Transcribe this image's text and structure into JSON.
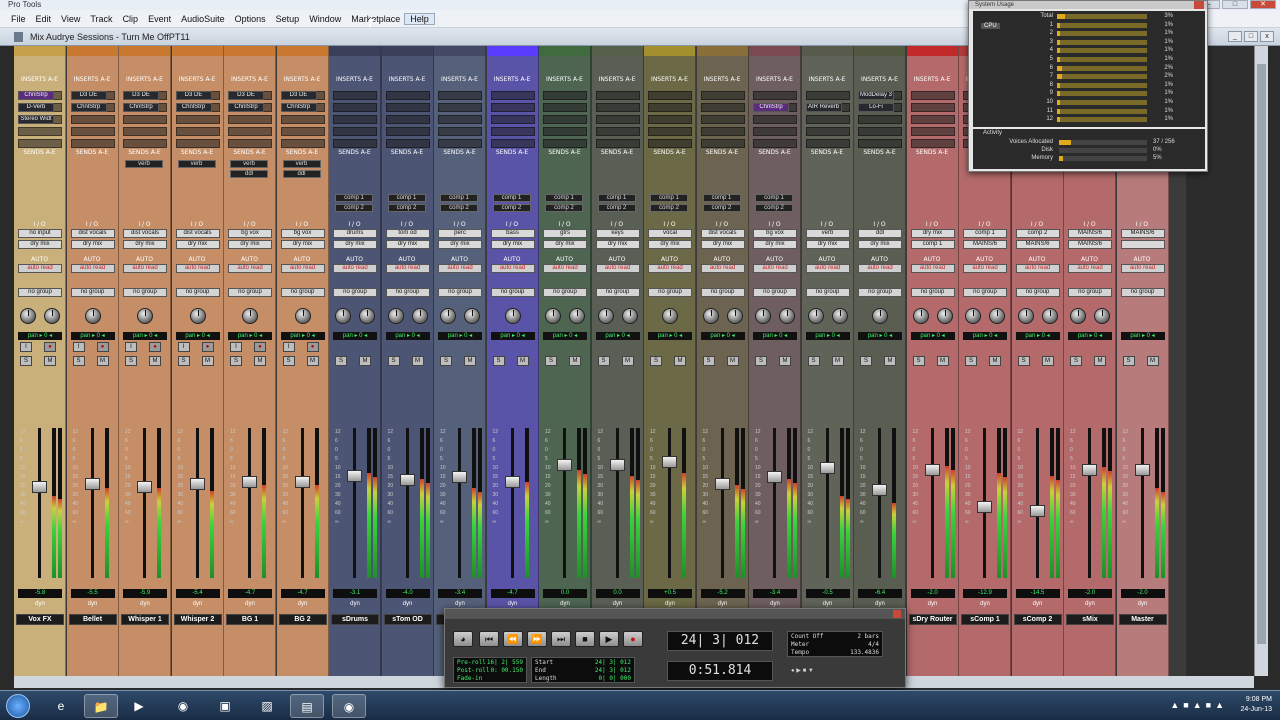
{
  "app": {
    "window_title": "Pro Tools",
    "session_title": "Mix Audrye Sessions - Turn Me OffPT11"
  },
  "menu": [
    "File",
    "Edit",
    "View",
    "Track",
    "Clip",
    "Event",
    "AudioSuite",
    "Options",
    "Setup",
    "Window",
    "Marketplace",
    "Help"
  ],
  "mixer": {
    "inserts_label": "INSERTS A-E",
    "sends_label": "SENDS A-E",
    "io_label": "I / O",
    "auto_label": "AUTO",
    "auto_mode": "auto read",
    "group_label": "no group",
    "pan_value": "pan ▸ 0 ◂",
    "dyn_label": "dyn",
    "scale": [
      "12",
      "6",
      "0",
      "5",
      "10",
      "15",
      "20",
      "30",
      "40",
      "60",
      "∞"
    ],
    "strips": [
      {
        "name": "Vox FX",
        "color": "#c9b07a",
        "top": "#c8a24a",
        "inserts": [
          "ChnlStrp",
          "D-Verb",
          "Stereo Widt"
        ],
        "sends": [],
        "input": "no input",
        "output": "dry mix",
        "vol": "-5.8",
        "fader": 0.38,
        "meter": 0.55,
        "knobs": 2
      },
      {
        "name": "Bellet",
        "color": "#c58e66",
        "top": "#c8792f",
        "inserts": [
          "D3 DE",
          "ChnlStrp"
        ],
        "sends": [],
        "input": "dist vocals",
        "output": "dry mix",
        "vol": "-5.5",
        "fader": 0.36,
        "meter": 0.6,
        "knobs": 1
      },
      {
        "name": "Whisper 1",
        "color": "#c58e66",
        "top": "#c8792f",
        "inserts": [
          "D3 DE",
          "ChnlStrp"
        ],
        "sends": [
          "verb"
        ],
        "input": "dist vocals",
        "output": "dry mix",
        "vol": "-5.9",
        "fader": 0.38,
        "meter": 0.6,
        "knobs": 1
      },
      {
        "name": "Whisper 2",
        "color": "#c58e66",
        "top": "#c8792f",
        "inserts": [
          "D3 DE",
          "ChnlStrp"
        ],
        "sends": [
          "verb"
        ],
        "input": "dist vocals",
        "output": "dry mix",
        "vol": "-5.4",
        "fader": 0.36,
        "meter": 0.58,
        "knobs": 1
      },
      {
        "name": "BG 1",
        "color": "#c58e66",
        "top": "#c8792f",
        "inserts": [
          "D3 DE",
          "ChnlStrp"
        ],
        "sends": [
          "verb",
          "ddl"
        ],
        "input": "bg vox",
        "output": "dry mix",
        "vol": "-4.7",
        "fader": 0.34,
        "meter": 0.62,
        "knobs": 1
      },
      {
        "name": "BG 2",
        "color": "#c58e66",
        "top": "#c8792f",
        "inserts": [
          "D3 DE",
          "ChnlStrp"
        ],
        "sends": [
          "verb",
          "ddl"
        ],
        "input": "bg vox",
        "output": "dry mix",
        "vol": "-4.7",
        "fader": 0.34,
        "meter": 0.62,
        "knobs": 1
      },
      {
        "name": "sDrums",
        "color": "#4d5574",
        "top": "#3c3f5a",
        "inserts": [],
        "sends": [
          "comp 1",
          "comp 2"
        ],
        "input": "drums",
        "output": "dry mix",
        "vol": "-3.1",
        "fader": 0.3,
        "meter": 0.7,
        "knobs": 2
      },
      {
        "name": "sTom OD",
        "color": "#4d5574",
        "top": "#3c3f5a",
        "inserts": [],
        "sends": [
          "comp 1",
          "comp 2"
        ],
        "input": "tom od",
        "output": "dry mix",
        "vol": "-4.0",
        "fader": 0.33,
        "meter": 0.66,
        "knobs": 2
      },
      {
        "name": "sPerc",
        "color": "#55607a",
        "top": "#444a66",
        "inserts": [],
        "sends": [
          "comp 1",
          "comp 2"
        ],
        "input": "perc",
        "output": "dry mix",
        "vol": "-3.4",
        "fader": 0.31,
        "meter": 0.6,
        "knobs": 2
      },
      {
        "name": "sBass",
        "color": "#5a54a8",
        "top": "#5a3cff",
        "inserts": [],
        "sends": [
          "comp 1",
          "comp 2"
        ],
        "input": "bass",
        "output": "dry mix",
        "vol": "-4.7",
        "fader": 0.34,
        "meter": 0.64,
        "knobs": 1
      },
      {
        "name": "sGtrs",
        "color": "#4e6552",
        "top": "#406b3f",
        "inserts": [],
        "sends": [
          "comp 1",
          "comp 2"
        ],
        "input": "gtrs",
        "output": "dry mix",
        "vol": "0.0",
        "fader": 0.22,
        "meter": 0.72,
        "knobs": 2
      },
      {
        "name": "sKeys",
        "color": "#5a5f55",
        "top": "#56604a",
        "inserts": [],
        "sends": [
          "comp 1",
          "comp 2"
        ],
        "input": "keys",
        "output": "dry mix",
        "vol": "0.0",
        "fader": 0.22,
        "meter": 0.68,
        "knobs": 2
      },
      {
        "name": "sVocal",
        "color": "#6c6946",
        "top": "#a38f2e",
        "inserts": [],
        "sends": [
          "comp 1",
          "comp 2"
        ],
        "input": "vocal",
        "output": "dry mix",
        "vol": "+0.5",
        "fader": 0.2,
        "meter": 0.7,
        "knobs": 1
      },
      {
        "name": "sDistVocals",
        "color": "#6c6450",
        "top": "#8a6e3a",
        "inserts": [],
        "sends": [
          "comp 1",
          "comp 2"
        ],
        "input": "dist vocals",
        "output": "dry mix",
        "vol": "-5.2",
        "fader": 0.36,
        "meter": 0.62,
        "knobs": 2
      },
      {
        "name": "sBG Vox",
        "color": "#6e5e60",
        "top": "#7a4a50",
        "inserts": [
          "ChnlStrp"
        ],
        "sends": [
          "comp 1",
          "comp 2"
        ],
        "input": "bg vox",
        "output": "dry mix",
        "vol": "-3.4",
        "fader": 0.31,
        "meter": 0.66,
        "knobs": 2
      },
      {
        "name": "xVerb",
        "color": "#5f6358",
        "top": "#575a4d",
        "inserts": [
          "AIR Reverb"
        ],
        "sends": [],
        "input": "verb",
        "output": "dry mix",
        "vol": "-0.5",
        "fader": 0.24,
        "meter": 0.55,
        "knobs": 2
      },
      {
        "name": "xDDL",
        "color": "#5a5e52",
        "top": "#52573f",
        "inserts": [
          "ModDelay 3",
          "Lo-Fi"
        ],
        "sends": [],
        "input": "ddl",
        "output": "dry mix",
        "vol": "-6.4",
        "fader": 0.4,
        "meter": 0.5,
        "knobs": 1
      },
      {
        "name": "sDry Router",
        "color": "#b46a6a",
        "top": "#c22a2a",
        "inserts": [],
        "sends": [],
        "input": "dry mix",
        "output": "comp 1",
        "vol": "-2.0",
        "fader": 0.26,
        "meter": 0.75,
        "knobs": 2
      },
      {
        "name": "sComp 1",
        "color": "#b46a6a",
        "top": "#b33a3a",
        "inserts": [],
        "sends": [],
        "input": "comp 1",
        "output": "MAINS/6",
        "vol": "-12.9",
        "fader": 0.52,
        "meter": 0.7,
        "knobs": 2
      },
      {
        "name": "sComp 2",
        "color": "#b46a6a",
        "top": "#b33a3a",
        "inserts": [],
        "sends": [],
        "input": "comp 2",
        "output": "MAINS/6",
        "vol": "-14.5",
        "fader": 0.55,
        "meter": 0.68,
        "knobs": 2
      },
      {
        "name": "sMix",
        "color": "#b46a6a",
        "top": "#b33a3a",
        "inserts": [],
        "sends": [],
        "input": "MAINS/6",
        "output": "MAINS/6",
        "vol": "-2.0",
        "fader": 0.26,
        "meter": 0.74,
        "knobs": 2
      },
      {
        "name": "Master",
        "color": "#b77b7b",
        "top": "#a82a2a",
        "inserts": [],
        "sends": [],
        "input": "MAINS/6",
        "output": "",
        "vol": "-2.0",
        "fader": 0.26,
        "meter": 0.6,
        "knobs": 0
      }
    ]
  },
  "cpu_window": {
    "title": "System Usage",
    "cpu_tab": "CPU",
    "total_label": "Total",
    "total_value": "3%",
    "cores": [
      {
        "label": "1",
        "value": "1%"
      },
      {
        "label": "2",
        "value": "1%"
      },
      {
        "label": "3",
        "value": "1%"
      },
      {
        "label": "4",
        "value": "1%"
      },
      {
        "label": "5",
        "value": "1%"
      },
      {
        "label": "6",
        "value": "2%"
      },
      {
        "label": "7",
        "value": "2%"
      },
      {
        "label": "8",
        "value": "1%"
      },
      {
        "label": "9",
        "value": "1%"
      },
      {
        "label": "10",
        "value": "1%"
      },
      {
        "label": "11",
        "value": "1%"
      },
      {
        "label": "12",
        "value": "1%"
      }
    ],
    "activity_title": "Activity",
    "voices_label": "Voices Allocated",
    "voices_value": "37 / 256",
    "disk_label": "Disk",
    "disk_value": "0%",
    "memory_label": "Memory",
    "memory_value": "5%"
  },
  "transport": {
    "main_counter": "24| 3| 012",
    "sub_counter": "0:51.814",
    "count_off": "Count Off",
    "count_bars": "2 bars",
    "meter_label": "Meter",
    "meter_value": "4/4",
    "tempo_label": "Tempo",
    "tempo_value": "133.4836",
    "preroll_label": "Pre-roll",
    "preroll_value": "16| 2| 559",
    "postroll_label": "Post-roll",
    "postroll_value": "0: 00.150",
    "fadein_label": "Fade-in",
    "start_label": "Start",
    "start_value": "24| 3| 012",
    "end_label": "End",
    "end_value": "24| 3| 012",
    "length_label": "Length",
    "length_value": "0| 0| 000"
  },
  "taskbar": {
    "time": "9:08 PM",
    "date": "24-Jun-13",
    "items": [
      "ie-icon",
      "media-player-icon",
      "firefox-icon",
      "app-icon",
      "explorer-icon",
      "folder-icon",
      "pro-tools-icon",
      "pro-tools-doc-icon"
    ]
  }
}
